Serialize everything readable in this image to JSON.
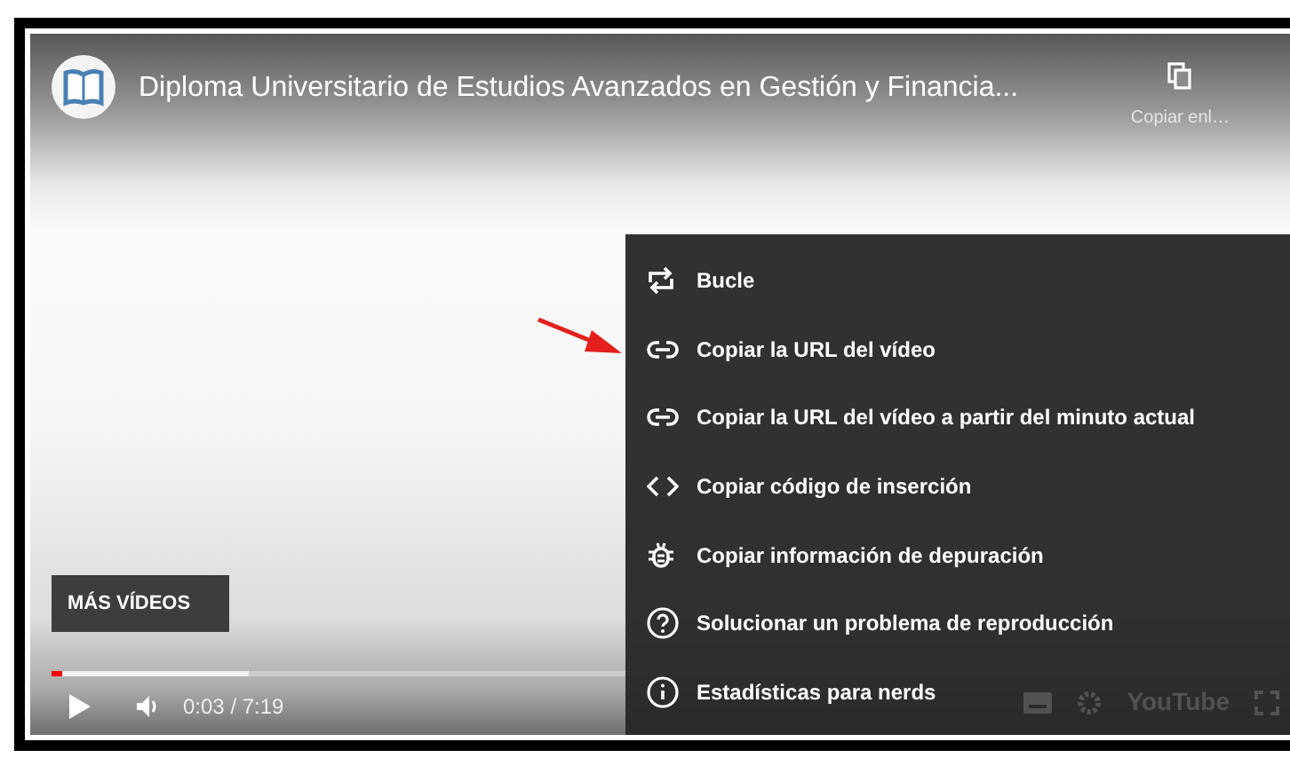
{
  "player": {
    "title": "Diploma Universitario de Estudios Avanzados en Gestión y Financia...",
    "share": {
      "label": "Copiar enl…"
    },
    "more_videos_button": "MÁS VÍDEOS",
    "progress": {
      "level": 0.008,
      "buffered": {
        "level": 0.16
      }
    },
    "time": "0:03 / 7:19",
    "logo_text": "YouTube"
  },
  "context_menu": [
    {
      "kind": "loop",
      "label": "Bucle"
    },
    {
      "kind": "link",
      "label": "Copiar la URL del vídeo"
    },
    {
      "kind": "link",
      "label": "Copiar la URL del vídeo a partir del minuto actual"
    },
    {
      "kind": "code",
      "label": "Copiar código de inserción"
    },
    {
      "kind": "bug",
      "label": "Copiar información de depuración"
    },
    {
      "kind": "help",
      "label": "Solucionar un problema de reproducción"
    },
    {
      "kind": "info",
      "label": "Estadísticas para nerds"
    }
  ]
}
